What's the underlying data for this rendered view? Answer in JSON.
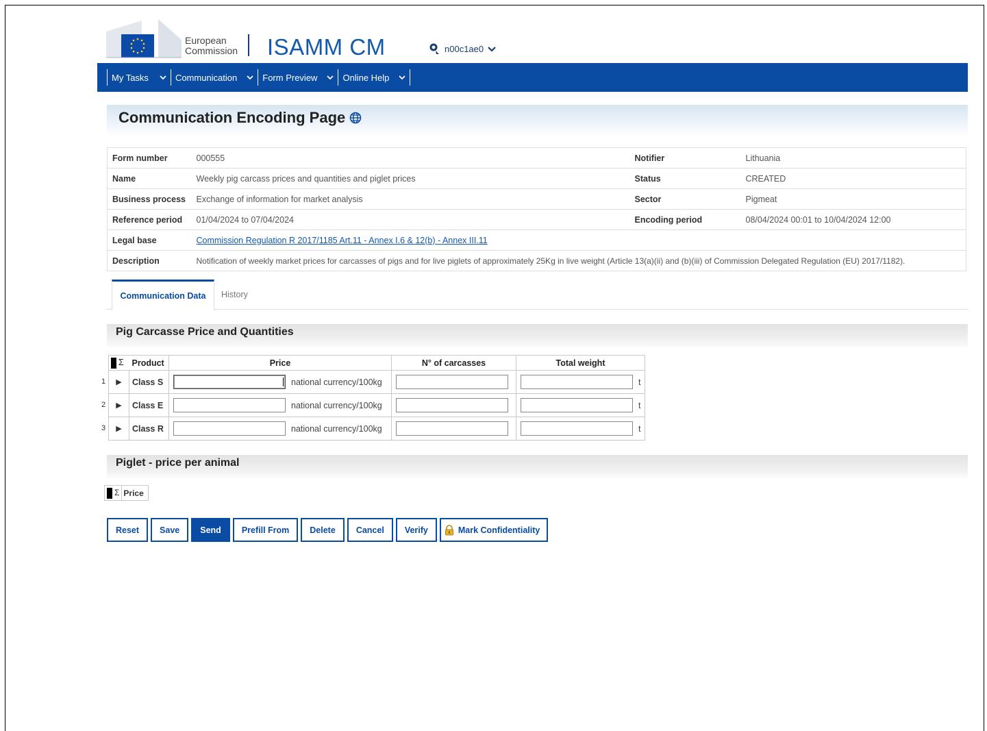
{
  "header": {
    "org_line1": "European",
    "org_line2": "Commission",
    "app_title": "ISAMM CM",
    "user": "n00c1ae0"
  },
  "nav": [
    {
      "label": "My Tasks"
    },
    {
      "label": "Communication"
    },
    {
      "label": "Form Preview"
    },
    {
      "label": "Online Help"
    }
  ],
  "page": {
    "title": "Communication Encoding Page"
  },
  "info": {
    "form_number_label": "Form number",
    "form_number": "000555",
    "notifier_label": "Notifier",
    "notifier": "Lithuania",
    "name_label": "Name",
    "name": "Weekly pig carcass prices and quantities and piglet prices",
    "status_label": "Status",
    "status": "CREATED",
    "business_process_label": "Business process",
    "business_process": "Exchange of information for market analysis",
    "sector_label": "Sector",
    "sector": "Pigmeat",
    "reference_period_label": "Reference period",
    "reference_period": "01/04/2024 to 07/04/2024",
    "encoding_period_label": "Encoding period",
    "encoding_period": "08/04/2024 00:01 to 10/04/2024 12:00",
    "legal_base_label": "Legal base",
    "legal_base": "Commission Regulation R 2017/1185 Art.11 - Annex I.6 & 12(b) - Annex III.11",
    "description_label": "Description",
    "description": "Notification of weekly market prices for carcasses of pigs and for live piglets of approximately 25Kg in live weight (Article 13(a)(ii) and (b)(iii) of Commission Delegated Regulation (EU) 2017/1182)."
  },
  "tabs": [
    {
      "label": "Communication Data",
      "active": true
    },
    {
      "label": "History",
      "active": false
    }
  ],
  "section1": {
    "title": "Pig Carcasse Price and Quantities",
    "headers": {
      "sigma": "Σ",
      "product": "Product",
      "price": "Price",
      "carcasses": "N° of carcasses",
      "weight": "Total weight"
    },
    "rows": [
      {
        "num": "1",
        "product": "Class S",
        "price": "",
        "price_unit": "national currency/100kg",
        "carcasses": "",
        "weight": "",
        "weight_unit": "t"
      },
      {
        "num": "2",
        "product": "Class E",
        "price": "",
        "price_unit": "national currency/100kg",
        "carcasses": "",
        "weight": "",
        "weight_unit": "t"
      },
      {
        "num": "3",
        "product": "Class R",
        "price": "",
        "price_unit": "national currency/100kg",
        "carcasses": "",
        "weight": "",
        "weight_unit": "t"
      }
    ]
  },
  "section2": {
    "title": "Piglet - price per animal",
    "headers": {
      "sigma": "Σ",
      "price": "Price"
    }
  },
  "buttons": {
    "reset": "Reset",
    "save": "Save",
    "send": "Send",
    "prefill": "Prefill From",
    "delete": "Delete",
    "cancel": "Cancel",
    "verify": "Verify",
    "confidentiality": "Mark Confidentiality"
  },
  "colors": {
    "brand_blue": "#0a4ba3",
    "title_blue": "#1259b0"
  }
}
